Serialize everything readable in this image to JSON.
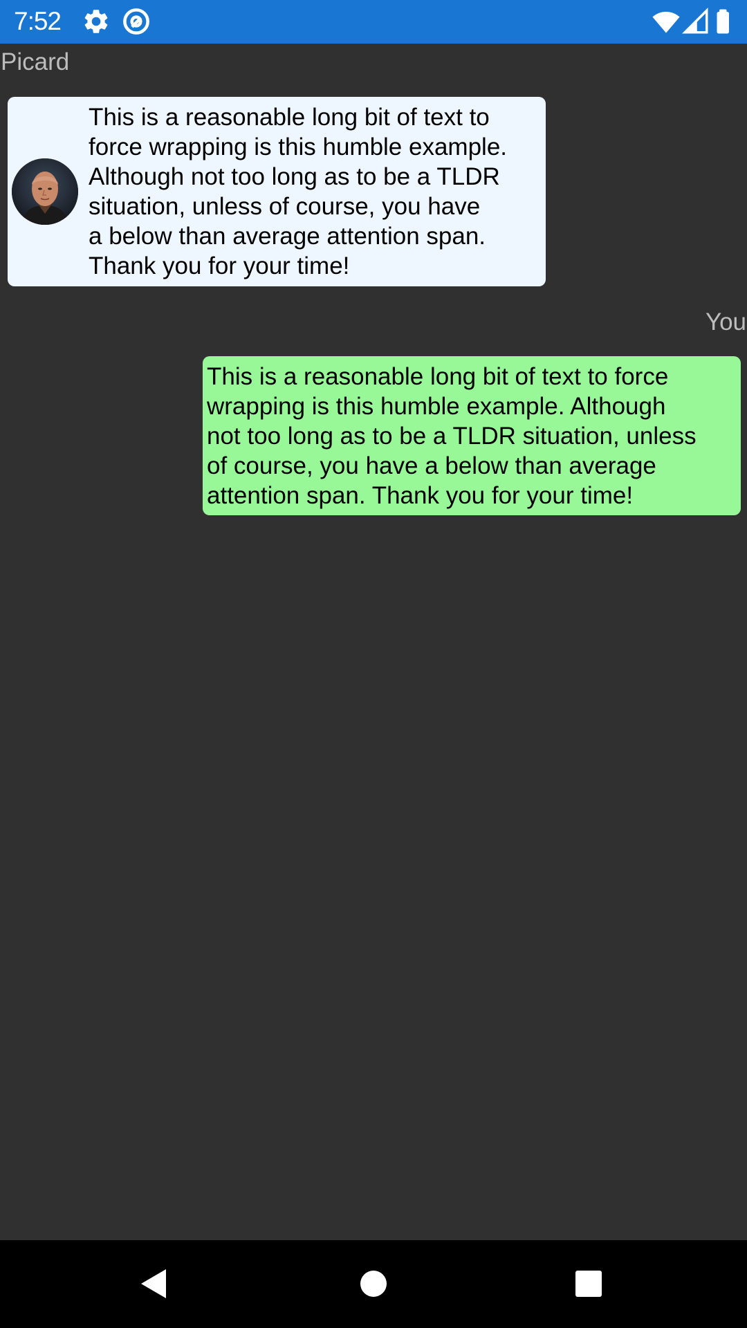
{
  "status_bar": {
    "time": "7:52",
    "color": "#1976d2",
    "icons": [
      "gear-icon",
      "at-sign-icon",
      "wifi-icon",
      "cell-signal-icon",
      "battery-icon"
    ]
  },
  "chat": {
    "incoming": {
      "sender": "Picard",
      "avatar": "picard-avatar",
      "text": "This is a reasonable long bit of text to\nforce wrapping is this humble example.\nAlthough not too long as to be a TLDR\nsituation, unless of course, you have\na below than average attention span.\nThank you for your time!",
      "color": "#eef6ff"
    },
    "outgoing": {
      "sender": "You",
      "text": "This is a reasonable long bit of text to force\nwrapping is this humble example. Although\nnot too long as to be a TLDR situation, unless\nof course, you have a below than average\nattention span. Thank you for your time!",
      "color": "#98f898"
    }
  },
  "nav_bar": {
    "buttons": [
      "back-icon",
      "home-icon",
      "recents-icon"
    ]
  }
}
